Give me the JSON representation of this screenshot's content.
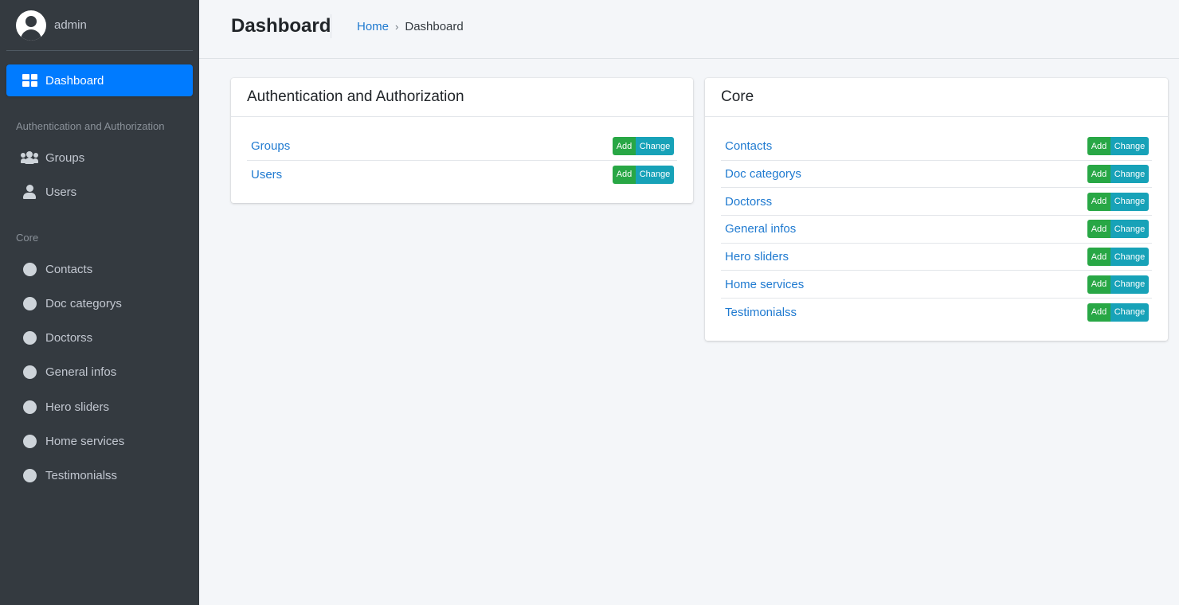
{
  "sidebar": {
    "username": "admin",
    "active_item": "Dashboard",
    "sections": [
      {
        "header": "Authentication and Authorization",
        "items": [
          {
            "label": "Groups",
            "icon": "users-icon"
          },
          {
            "label": "Users",
            "icon": "user-icon"
          }
        ]
      },
      {
        "header": "Core",
        "items": [
          {
            "label": "Contacts",
            "icon": "circle-icon"
          },
          {
            "label": "Doc categorys",
            "icon": "circle-icon"
          },
          {
            "label": "Doctorss",
            "icon": "circle-icon"
          },
          {
            "label": "General infos",
            "icon": "circle-icon"
          },
          {
            "label": "Hero sliders",
            "icon": "circle-icon"
          },
          {
            "label": "Home services",
            "icon": "circle-icon"
          },
          {
            "label": "Testimonialss",
            "icon": "circle-icon"
          }
        ]
      }
    ]
  },
  "header": {
    "title": "Dashboard",
    "breadcrumb": {
      "home": "Home",
      "separator": "›",
      "current": "Dashboard"
    }
  },
  "cards": [
    {
      "title": "Authentication and Authorization",
      "models": [
        "Groups",
        "Users"
      ]
    },
    {
      "title": "Core",
      "models": [
        "Contacts",
        "Doc categorys",
        "Doctorss",
        "General infos",
        "Hero sliders",
        "Home services",
        "Testimonialss"
      ]
    }
  ],
  "actions": {
    "add_label": "Add",
    "change_label": "Change"
  },
  "colors": {
    "sidebar_bg": "#343a40",
    "active_nav": "#007bff",
    "link": "#1f7ad0",
    "add_button": "#28a745",
    "change_button": "#17a2b8",
    "page_bg": "#f4f6f9"
  }
}
